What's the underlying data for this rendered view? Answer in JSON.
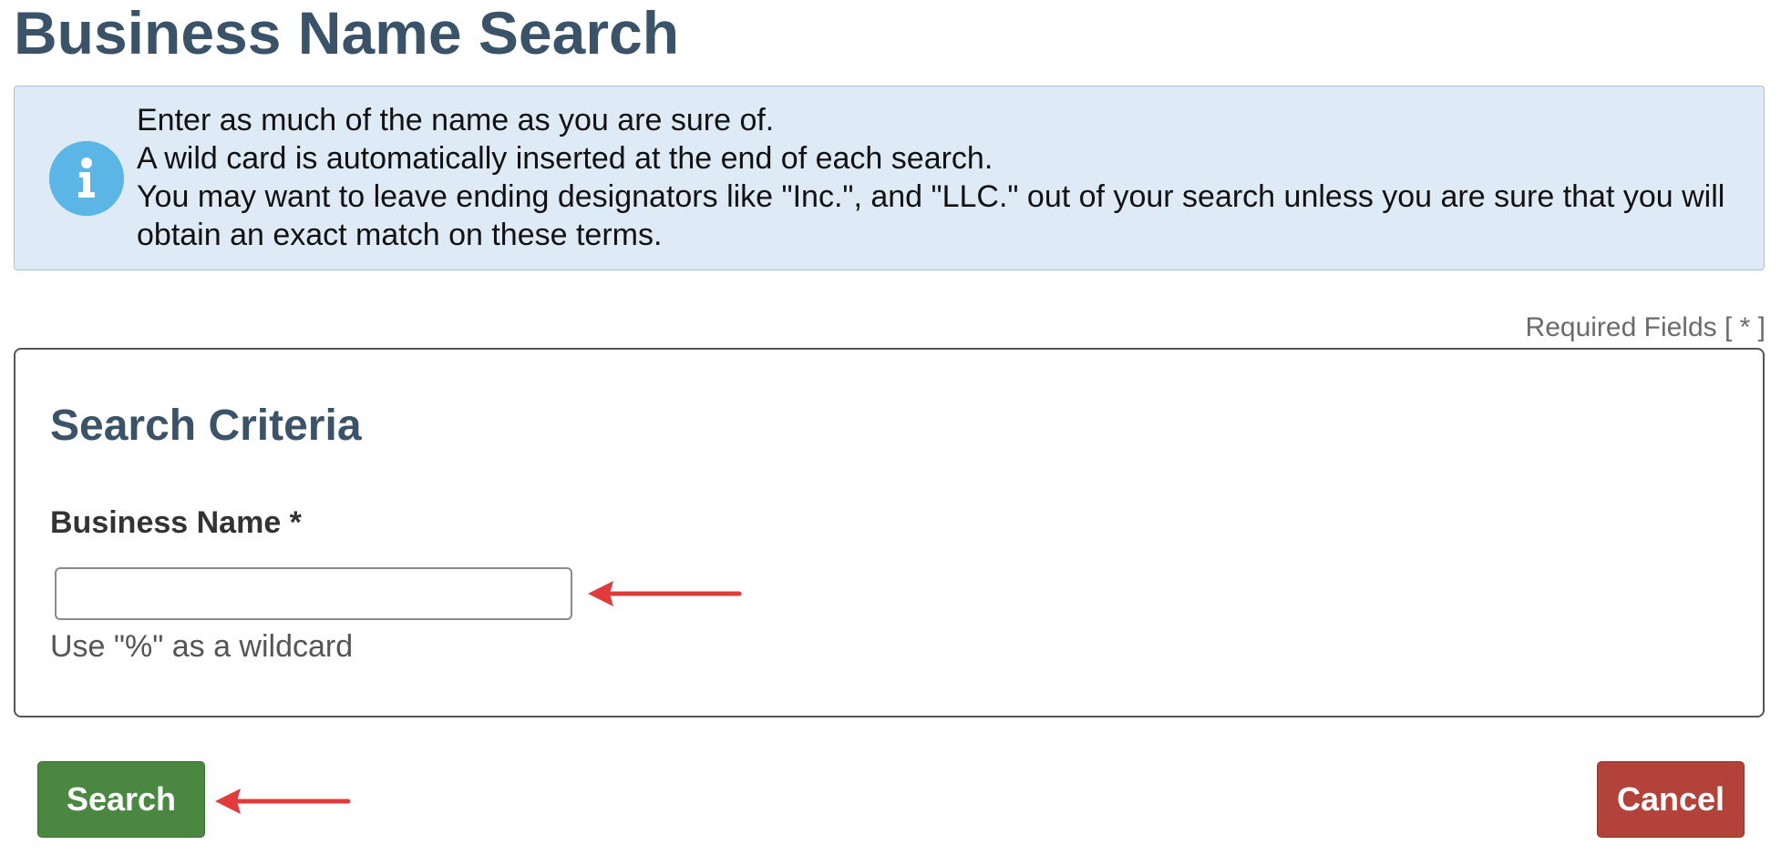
{
  "page": {
    "title": "Business Name Search"
  },
  "info": {
    "icon": "info-icon",
    "lines": [
      "Enter as much of the name as you are sure of.",
      "A wild card is automatically inserted at the end of each search.",
      "You may want to leave ending designators like \"Inc.\", and \"LLC.\" out of your search unless you are sure that you will obtain an exact match on these terms."
    ]
  },
  "required_note": "Required Fields [ * ]",
  "criteria": {
    "title": "Search Criteria",
    "business_name": {
      "label": "Business Name *",
      "value": "",
      "placeholder": "",
      "help": "Use \"%\" as a wildcard"
    }
  },
  "actions": {
    "search_label": "Search",
    "cancel_label": "Cancel"
  },
  "colors": {
    "heading": "#3a5369",
    "info_bg": "#deebf7",
    "info_icon": "#5bb6e6",
    "search_button": "#4a8740",
    "cancel_button": "#b2423a",
    "annotation_arrow": "#e03c3c"
  }
}
